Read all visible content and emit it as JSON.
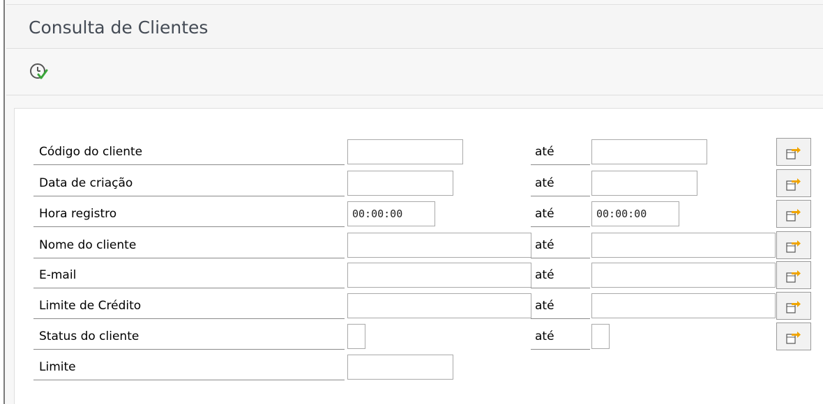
{
  "window": {
    "title": "Consulta de Clientes"
  },
  "toolbar": {
    "execute_icon": "execute-clock-check-icon"
  },
  "form": {
    "rows": [
      {
        "label": "Código do cliente",
        "to_label": "até",
        "from_value": "",
        "to_value": "",
        "has_multi": true
      },
      {
        "label": "Data de criação",
        "to_label": "até",
        "from_value": "",
        "to_value": "",
        "has_multi": true
      },
      {
        "label": "Hora registro",
        "to_label": "até",
        "from_value": "00:00:00",
        "to_value": "00:00:00",
        "has_multi": true
      },
      {
        "label": "Nome do cliente",
        "to_label": "até",
        "from_value": "",
        "to_value": "",
        "has_multi": true
      },
      {
        "label": "E-mail",
        "to_label": "até",
        "from_value": "",
        "to_value": "",
        "has_multi": true
      },
      {
        "label": "Limite de Crédito",
        "to_label": "até",
        "from_value": "",
        "to_value": "",
        "has_multi": true
      },
      {
        "label": "Status do cliente",
        "to_label": "até",
        "from_value": "",
        "to_value": "",
        "has_multi": true
      },
      {
        "label": "Limite",
        "from_value": "",
        "has_multi": false
      }
    ],
    "multi_select_icon": "multiple-selection-arrow-icon"
  },
  "colors": {
    "title_text": "#444b55",
    "arrow_accent": "#f0a500",
    "check_accent": "#3aa63a"
  }
}
